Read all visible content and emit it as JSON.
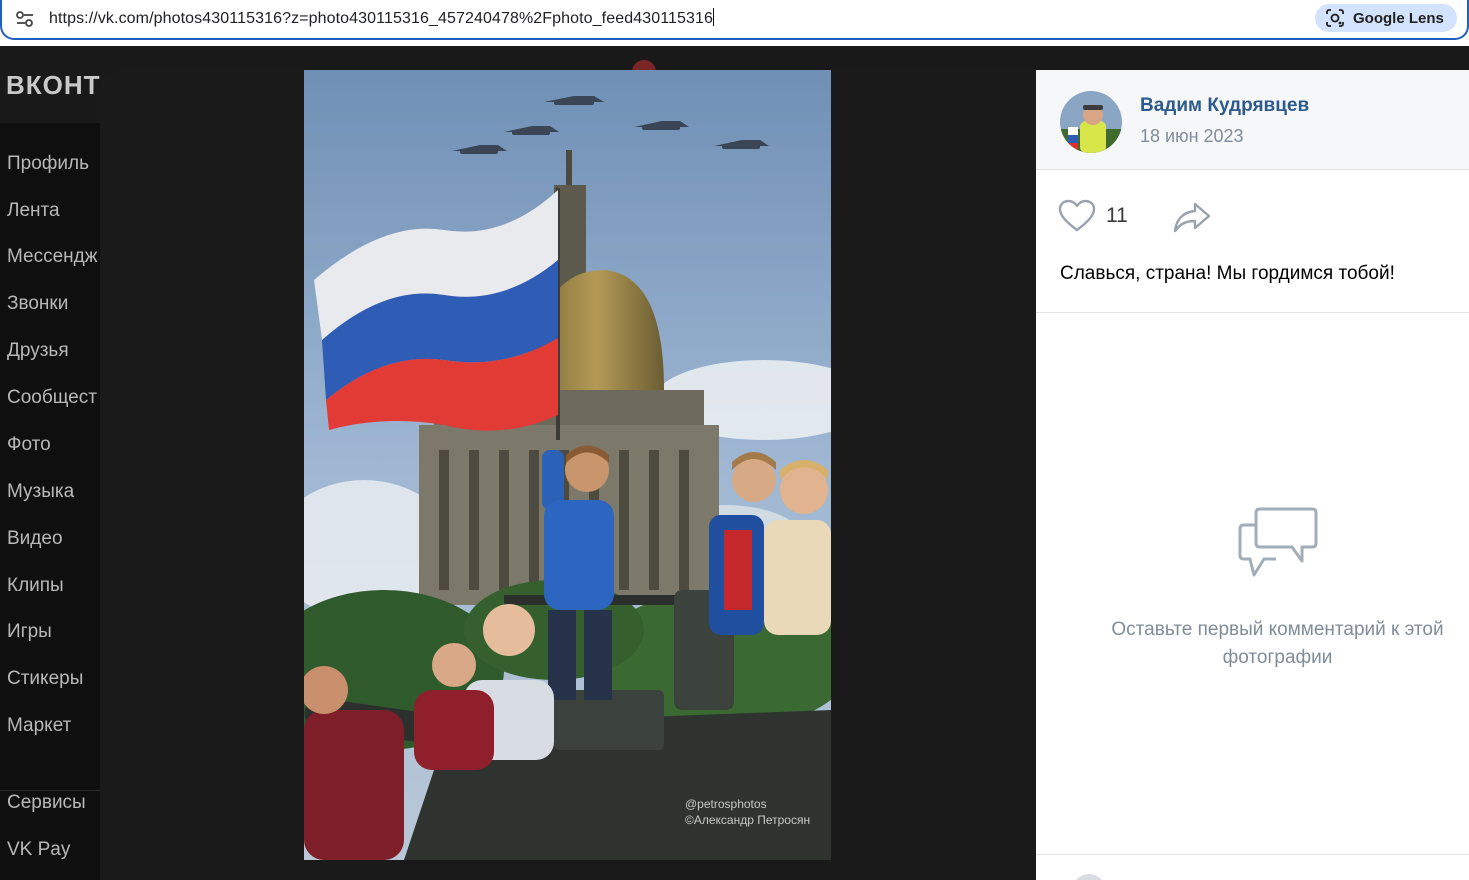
{
  "browser": {
    "url": "https://vk.com/photos430115316?z=photo430115316_457240478%2Fphoto_feed430115316",
    "lens_label": "Google Lens",
    "icons": [
      "tune-icon",
      "lens-icon"
    ]
  },
  "vk": {
    "logo": "ВКОНТ",
    "sidebar": {
      "items": [
        {
          "label": "Профиль"
        },
        {
          "label": "Лента"
        },
        {
          "label": "Мессендж"
        },
        {
          "label": "Звонки"
        },
        {
          "label": "Друзья"
        },
        {
          "label": "Сообщест"
        },
        {
          "label": "Фото"
        },
        {
          "label": "Музыка"
        },
        {
          "label": "Видео"
        },
        {
          "label": "Клипы"
        },
        {
          "label": "Игры"
        },
        {
          "label": "Стикеры"
        },
        {
          "label": "Маркет"
        }
      ],
      "bottom_items": [
        {
          "label": "Сервисы"
        },
        {
          "label": "VK Pay"
        }
      ]
    }
  },
  "viewer": {
    "watermark_line1": "@petrosphotos",
    "watermark_line2": "©Александр Петросян",
    "author": {
      "name": "Вадим Кудрявцев",
      "date": "18 июн 2023"
    },
    "likes": "11",
    "caption": "Славься, страна! Мы гордимся тобой!",
    "empty_comments": "Оставьте первый комментарий к этой фотографии",
    "icons": [
      "heart-icon",
      "share-icon",
      "comments-icon"
    ]
  },
  "colors": {
    "accent": "#2c5a8c",
    "muted": "#818c99",
    "address_border": "#1f5fbf",
    "lens_bg": "#d3e3fd"
  }
}
